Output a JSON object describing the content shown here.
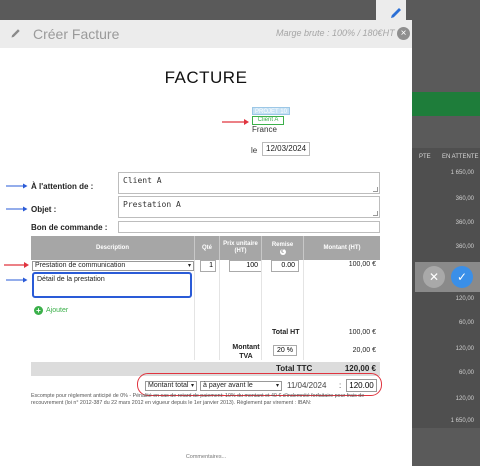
{
  "modal": {
    "title": "Créer Facture",
    "header_info": "Marge brute : 100% / 180€HT",
    "close_glyph": "×"
  },
  "invoice": {
    "title": "FACTURE",
    "project_badge": "PROJET 10",
    "client_badge": "Client A",
    "country": "France",
    "date_prefix": "le",
    "date_value": "12/03/2024"
  },
  "fields": {
    "attention_label": "À l'attention de :",
    "attention_value": "Client A",
    "objet_label": "Objet :",
    "objet_value": "Prestation A",
    "bon_label": "Bon de commande :",
    "bon_value": ""
  },
  "table": {
    "headers": {
      "description": "Description",
      "qte": "Qté",
      "prix_unitaire": "Prix unitaire (HT)",
      "remise": "Remise",
      "remise_icon": "€",
      "montant": "Montant (HT)"
    },
    "line": {
      "description": "Prestation de communication",
      "detail": "Détail de la prestation",
      "qte": "1",
      "prix_unitaire": "100",
      "remise": "0.00",
      "montant": "100,00 €"
    },
    "add_label": "Ajouter"
  },
  "totals": {
    "total_ht_label": "Total HT",
    "total_ht_value": "100,00 €",
    "tva_label": "Montant TVA",
    "tva_rate": "20 %",
    "tva_value": "20,00 €",
    "ttc_label": "Total TTC",
    "ttc_value": "120,00 €"
  },
  "payment": {
    "type_select": "Montant total",
    "condition_select": "à payer avant le",
    "due_date": "11/04/2024",
    "separator": ":",
    "amount": "120.00"
  },
  "legal_text": "Escompte pour règlement anticipé de 0% - Pénalité en cas de retard de paiement: 10% du montant et 40 € d'indemnité forfaitaire pour frais de recouvrement (loi n° 2012-387 du 22 mars 2012 en vigueur depuis le 1er janvier 2013). Règlement par virement : IBAN:",
  "comments_label": "Commentaires...",
  "background": {
    "col_headers": [
      "PTE",
      "EN ATTENTE"
    ],
    "cells": [
      "1 650,00",
      "360,00",
      "360,00",
      "360,00",
      "120,00",
      "60,00",
      "120,00",
      "60,00",
      "120,00",
      "1 650,00"
    ]
  },
  "colors": {
    "accent_blue": "#2a5bd7",
    "annotation_red": "#e0343f",
    "add_green": "#3bb04a",
    "confirm_blue": "#3a8fe8"
  },
  "icons": {
    "header": "pencil-icon",
    "side_edit": "pencil-icon",
    "close": "close-icon",
    "add": "plus-circle-icon",
    "cancel": "x-circle-icon",
    "confirm": "check-circle-icon"
  }
}
